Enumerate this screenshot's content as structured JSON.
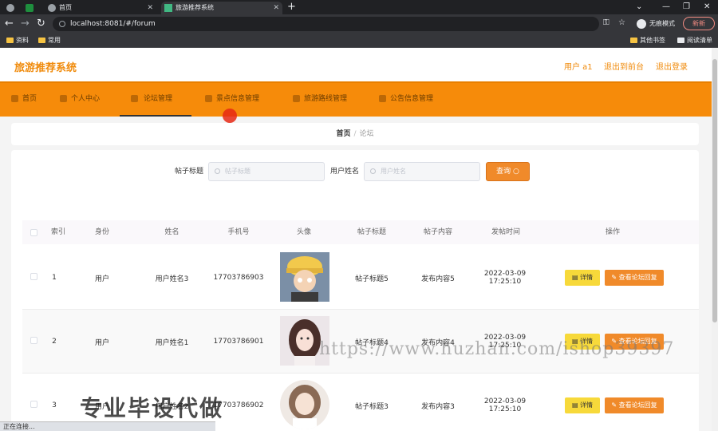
{
  "browser": {
    "tabs": [
      {
        "label": ""
      },
      {
        "label": ""
      },
      {
        "label": "首页"
      },
      {
        "label": "旅游推荐系统"
      }
    ],
    "url": "localhost:8081/#/forum",
    "incognito_label": "无痕模式",
    "update_label": "新新",
    "bookmarks": [
      "资料",
      "常用"
    ],
    "bookmarks_right": [
      "其他书签",
      "阅读清单"
    ],
    "status_text": "正在连接..."
  },
  "header": {
    "brand": "旅游推荐系统",
    "links": [
      "用户 a1",
      "退出到前台",
      "退出登录"
    ]
  },
  "menu": {
    "items": [
      {
        "label": "首页",
        "icon": "home-icon"
      },
      {
        "label": "个人中心",
        "icon": "user-icon"
      },
      {
        "label": "论坛管理",
        "icon": "forum-icon"
      },
      {
        "label": "景点信息管理",
        "icon": "grid-icon"
      },
      {
        "label": "旅游路线管理",
        "icon": "route-icon"
      },
      {
        "label": "公告信息管理",
        "icon": "notice-icon"
      }
    ],
    "active_index": 2
  },
  "breadcrumb": {
    "home": "首页",
    "sep": "/",
    "current": "论坛"
  },
  "search": {
    "title_label": "帖子标题",
    "title_placeholder": "帖子标题",
    "name_label": "用户姓名",
    "name_placeholder": "用户姓名",
    "button_label": "查询"
  },
  "table": {
    "columns": [
      "索引",
      "身份",
      "姓名",
      "手机号",
      "头像",
      "帖子标题",
      "帖子内容",
      "发帖时间",
      "操作"
    ],
    "rows": [
      {
        "index": "1",
        "role": "用户",
        "name": "用户姓名3",
        "phone": "17703786903",
        "title": "帖子标题5",
        "content": "发布内容5",
        "time": "2022-03-09 17:25:10"
      },
      {
        "index": "2",
        "role": "用户",
        "name": "用户姓名1",
        "phone": "17703786901",
        "title": "帖子标题4",
        "content": "发布内容4",
        "time": "2022-03-09 17:25:10"
      },
      {
        "index": "3",
        "role": "用户",
        "name": "用户姓名2",
        "phone": "17703786902",
        "title": "帖子标题3",
        "content": "发布内容3",
        "time": "2022-03-09 17:25:10"
      }
    ],
    "detail_label": "详情",
    "reply_label": "查看论坛回复"
  },
  "watermarks": {
    "url": "https://www.huzhan.com/ishop39397",
    "cn": "专业毕设代做"
  },
  "colors": {
    "accent": "#f68b0a",
    "brand": "#f08a0a",
    "detail_btn": "#f7d93a",
    "reply_btn": "#f08a2a"
  }
}
